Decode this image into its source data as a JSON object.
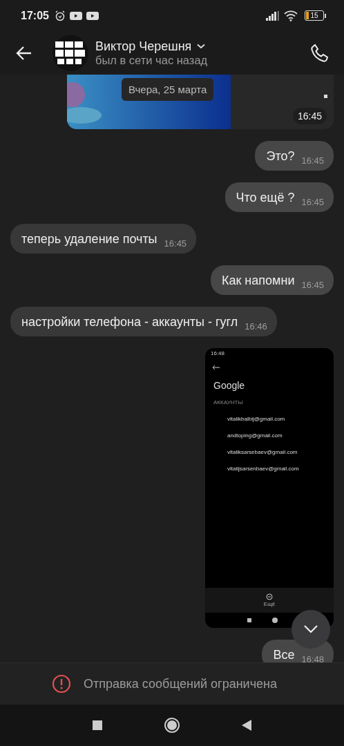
{
  "status_bar": {
    "time": "17:05",
    "battery": "15"
  },
  "header": {
    "contact_name": "Виктор Черешня",
    "presence": "был в сети час назад"
  },
  "date_pill": "Вчера, 25 марта",
  "messages": [
    {
      "outgoing": true,
      "time": "16:45"
    },
    {
      "kind": "text",
      "outgoing": true,
      "text": "Это?",
      "time": "16:45"
    },
    {
      "kind": "text",
      "outgoing": true,
      "text": "Что ещё ?",
      "time": "16:45"
    },
    {
      "kind": "text",
      "outgoing": false,
      "text": "теперь удаление почты",
      "time": "16:45"
    },
    {
      "kind": "text",
      "outgoing": true,
      "text": "Как напомни",
      "time": "16:45"
    },
    {
      "kind": "text",
      "outgoing": false,
      "text": "настройки телефона - аккаунты - гугл",
      "time": "16:46"
    },
    {
      "kind": "screenshot",
      "outgoing": true,
      "screen": {
        "time": "16:48",
        "title": "Google",
        "section": "АККАУНТЫ",
        "accounts": [
          "vitalikbalbij@gmail.com",
          "andtoping@gmail.com",
          "vitaliksarsebaev@gmail.com",
          "vitalijsarsenbaev@gmail.com"
        ],
        "more": "Ещё"
      }
    },
    {
      "kind": "text",
      "outgoing": true,
      "text": "Все",
      "time": "16:48"
    }
  ],
  "restriction": "Отправка сообщений ограничена"
}
